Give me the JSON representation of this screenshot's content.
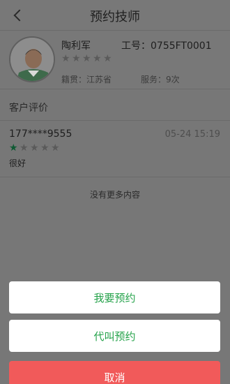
{
  "header": {
    "title": "预约技师"
  },
  "technician": {
    "name": "陶利军",
    "job_number_label": "工号：0755FT0001",
    "rating": 0,
    "origin": "籍贯：江苏省",
    "service_count": "服务：9次"
  },
  "reviews_section": {
    "title": "客户评价",
    "items": [
      {
        "phone": "177****9555",
        "time": "05-24 15:19",
        "stars": 1,
        "comment": "很好"
      }
    ]
  },
  "no_more": "没有更多内容",
  "actions": {
    "book": "我要预约",
    "book_for_other": "代叫预约",
    "cancel": "取消"
  },
  "colors": {
    "accent_green": "#24a24a",
    "cancel_red": "#f15a5a",
    "overlay": "#777777"
  }
}
